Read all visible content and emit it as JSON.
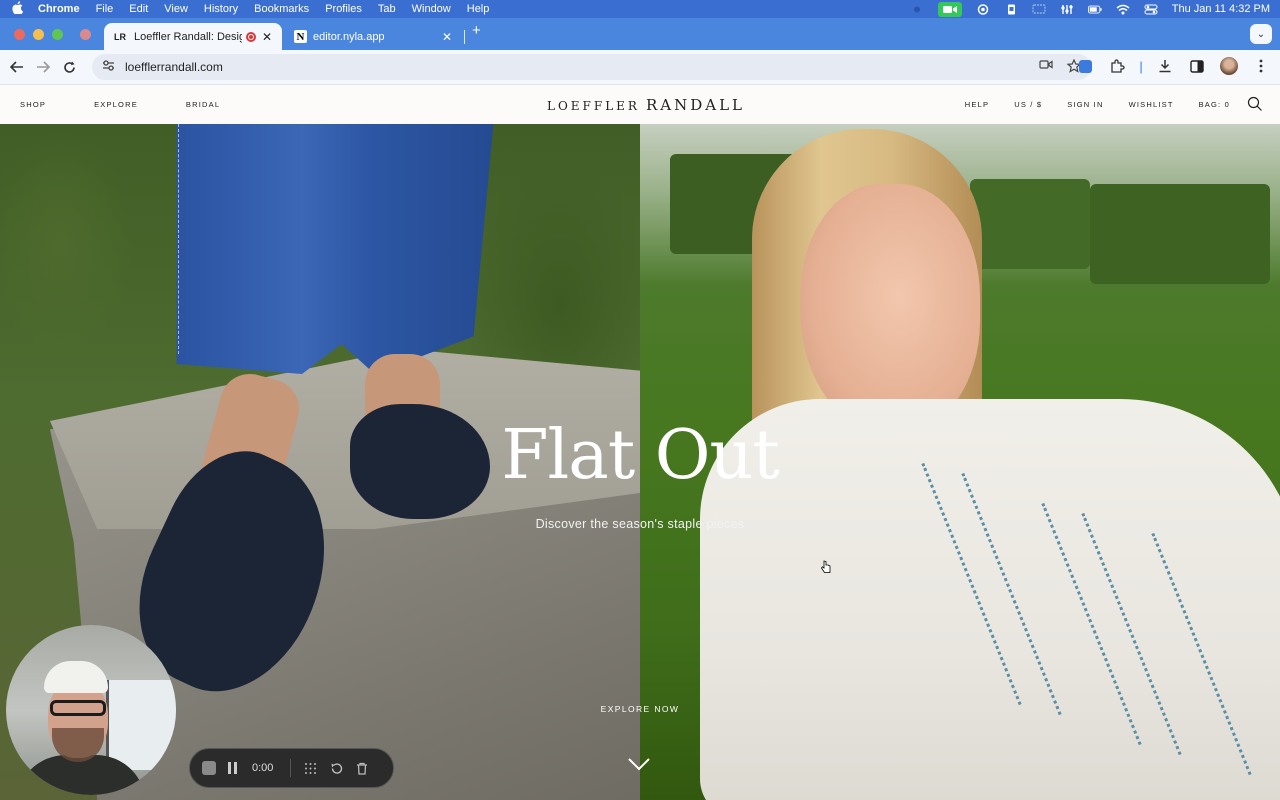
{
  "menubar": {
    "app": "Chrome",
    "menus": [
      "File",
      "Edit",
      "View",
      "History",
      "Bookmarks",
      "Profiles",
      "Tab",
      "Window",
      "Help"
    ],
    "clock": "Thu Jan 11  4:32 PM"
  },
  "tabs": [
    {
      "favicon": "LR",
      "title": "Loeffler Randall: Designer"
    },
    {
      "favicon": "N",
      "title": "editor.nyla.app"
    }
  ],
  "toolbar": {
    "url": "loefflerrandall.com"
  },
  "site": {
    "nav_left": [
      "SHOP",
      "EXPLORE",
      "BRIDAL"
    ],
    "logo_a": "LOEFFLER",
    "logo_b": "RANDALL",
    "nav_right": [
      "HELP",
      "US / $",
      "SIGN IN",
      "WISHLIST",
      "BAG: 0"
    ]
  },
  "hero": {
    "headline": "Flat Out",
    "subline": "Discover the season's staple pieces",
    "cta": "EXPLORE NOW"
  },
  "recorder": {
    "time": "0:00"
  },
  "colors": {
    "menubar": "#3a6fd1",
    "tabstrip": "#4a86de",
    "accent_red": "#d83a3a"
  }
}
